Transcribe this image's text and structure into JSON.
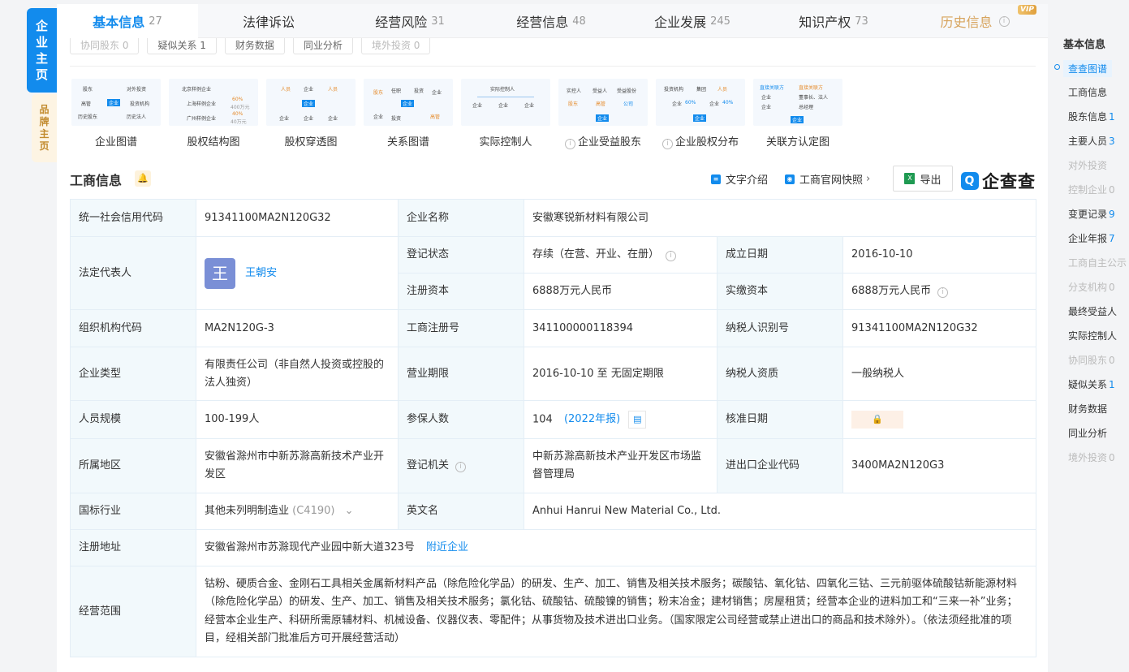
{
  "side_tabs": {
    "main": [
      "企",
      "业",
      "主",
      "页"
    ],
    "brand": [
      "品",
      "牌",
      "主",
      "页"
    ]
  },
  "tabs": [
    {
      "label": "基本信息",
      "count": "27"
    },
    {
      "label": "法律诉讼",
      "count": ""
    },
    {
      "label": "经营风险",
      "count": "31"
    },
    {
      "label": "经营信息",
      "count": "48"
    },
    {
      "label": "企业发展",
      "count": "245"
    },
    {
      "label": "知识产权",
      "count": "73"
    },
    {
      "label": "历史信息",
      "count": "",
      "badge": "VIP"
    }
  ],
  "subtabs": [
    {
      "label": "协同股东 0",
      "dim": true
    },
    {
      "label": "疑似关系 1",
      "dim": false
    },
    {
      "label": "财务数据",
      "dim": false
    },
    {
      "label": "同业分析",
      "dim": false
    },
    {
      "label": "境外投资 0",
      "dim": true
    }
  ],
  "thumbs": [
    {
      "label": "企业图谱",
      "info": false,
      "mini": [
        "股东",
        "对外投资",
        "高管",
        "企业",
        "投资机构",
        "历史股东",
        "历史法人"
      ]
    },
    {
      "label": "股权结构图",
      "info": false,
      "mini": [
        "北京样例企业",
        "上海样例企业",
        "60%",
        "400万元",
        "广州样例企业",
        "40%",
        "40万元"
      ]
    },
    {
      "label": "股权穿透图",
      "info": false,
      "mini": [
        "人员",
        "企业",
        "人员",
        "企业",
        "企业",
        "企业",
        "企业"
      ]
    },
    {
      "label": "关系图谱",
      "info": false,
      "mini": [
        "股东",
        "任职",
        "投资",
        "企业",
        "企业",
        "企业",
        "投资",
        "高管"
      ]
    },
    {
      "label": "实际控制人",
      "info": false,
      "mini": [
        "实际控制人",
        "企业",
        "企业",
        "企业"
      ]
    },
    {
      "label": "企业受益股东",
      "info": true,
      "mini": [
        "实控人",
        "受益人",
        "受益股份",
        "股东",
        "高管",
        "公司",
        "企业"
      ]
    },
    {
      "label": "企业股权分布",
      "info": true,
      "mini": [
        "投资机构",
        "集团",
        "人员",
        "企业",
        "60%",
        "企业",
        "40%",
        "企业"
      ]
    },
    {
      "label": "关联方认定图",
      "info": false,
      "mini": [
        "直接关联方",
        "直接关联方",
        "企业",
        "董事长、法人",
        "企业",
        "总经理",
        "企业"
      ]
    }
  ],
  "section": {
    "title": "工商信息",
    "bell_icon": "bell-icon",
    "text_intro": "文字介绍",
    "snapshot": "工商官网快照",
    "export": "导出",
    "brand": "企查查"
  },
  "info": {
    "credit_code_label": "统一社会信用代码",
    "credit_code": "91341100MA2N120G32",
    "company_name_label": "企业名称",
    "company_name": "安徽寒锐新材料有限公司",
    "legal_rep_label": "法定代表人",
    "legal_rep_avatar": "王",
    "legal_rep": "王朝安",
    "status_label": "登记状态",
    "status": "存续（在营、开业、在册）",
    "found_date_label": "成立日期",
    "found_date": "2016-10-10",
    "reg_capital_label": "注册资本",
    "reg_capital": "6888万元人民币",
    "paid_capital_label": "实缴资本",
    "paid_capital": "6888万元人民币",
    "org_code_label": "组织机构代码",
    "org_code": "MA2N120G-3",
    "reg_no_label": "工商注册号",
    "reg_no": "341100000118394",
    "taxpayer_id_label": "纳税人识别号",
    "taxpayer_id": "91341100MA2N120G32",
    "type_label": "企业类型",
    "type": "有限责任公司（非自然人投资或控股的法人独资）",
    "term_label": "营业期限",
    "term": "2016-10-10 至 无固定期限",
    "taxpayer_q_label": "纳税人资质",
    "taxpayer_q": "一般纳税人",
    "staff_label": "人员规模",
    "staff": "100-199人",
    "insured_label": "参保人数",
    "insured": "104",
    "insured_year": "(2022年报)",
    "approve_label": "核准日期",
    "region_label": "所属地区",
    "region": "安徽省滁州市中新苏滁高新技术产业开发区",
    "authority_label": "登记机关",
    "authority": "中新苏滁高新技术产业开发区市场监督管理局",
    "ie_code_label": "进出口企业代码",
    "ie_code": "3400MA2N120G3",
    "industry_label": "国标行业",
    "industry": "其他未列明制造业",
    "industry_code": "(C4190)",
    "en_name_label": "英文名",
    "en_name": "Anhui Hanrui New Material Co., Ltd.",
    "address_label": "注册地址",
    "address": "安徽省滁州市苏滁现代产业园中新大道323号",
    "nearby": "附近企业",
    "scope_label": "经营范围",
    "scope": "钴粉、硬质合金、金刚石工具相关金属新材料产品（除危险化学品）的研发、生产、加工、销售及相关技术服务；碳酸钴、氧化钴、四氧化三钴、三元前驱体硫酸钴新能源材料（除危险化学品）的研发、生产、加工、销售及相关技术服务；氯化钴、硫酸钴、硫酸镍的销售；粉末冶金；建材销售；房屋租赁；经营本企业的进料加工和“三来一补”业务；经营本企业生产、科研所需原辅材料、机械设备、仪器仪表、零配件；从事货物及技术进出口业务。（国家限定公司经营或禁止进出口的商品和技术除外）。（依法须经批准的项目，经相关部门批准后方可开展经营活动）"
  },
  "rnav": {
    "title": "基本信息",
    "items": [
      {
        "label": "查查图谱",
        "count": "",
        "state": "active"
      },
      {
        "label": "工商信息",
        "count": "",
        "state": "normal"
      },
      {
        "label": "股东信息",
        "count": "1",
        "state": "normal"
      },
      {
        "label": "主要人员",
        "count": "3",
        "state": "normal"
      },
      {
        "label": "对外投资",
        "count": "",
        "state": "dim"
      },
      {
        "label": "控制企业",
        "count": "0",
        "state": "dim"
      },
      {
        "label": "变更记录",
        "count": "9",
        "state": "normal"
      },
      {
        "label": "企业年报",
        "count": "7",
        "state": "normal"
      },
      {
        "label": "工商自主公示",
        "count": "",
        "state": "dim"
      },
      {
        "label": "分支机构",
        "count": "0",
        "state": "dim"
      },
      {
        "label": "最终受益人",
        "count": "",
        "state": "normal"
      },
      {
        "label": "实际控制人",
        "count": "",
        "state": "normal"
      },
      {
        "label": "协同股东",
        "count": "0",
        "state": "dim"
      },
      {
        "label": "疑似关系",
        "count": "1",
        "state": "normal"
      },
      {
        "label": "财务数据",
        "count": "",
        "state": "normal"
      },
      {
        "label": "同业分析",
        "count": "",
        "state": "normal"
      },
      {
        "label": "境外投资",
        "count": "0",
        "state": "dim"
      }
    ]
  }
}
